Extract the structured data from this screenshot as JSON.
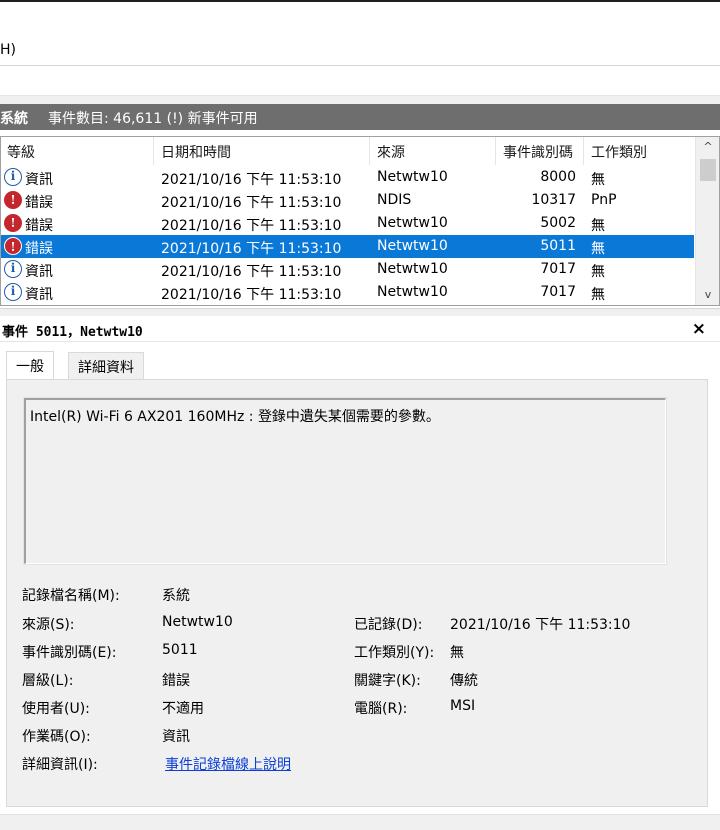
{
  "menubar": {
    "partial_item": "H)"
  },
  "header": {
    "title": "系統",
    "count_text": "事件數目: 46,611 (!) 新事件可用"
  },
  "grid": {
    "columns": [
      "等級",
      "日期和時間",
      "來源",
      "事件識別碼",
      "工作類別"
    ],
    "rows": [
      {
        "level": "資訊",
        "kind": "info",
        "datetime": "2021/10/16 下午 11:53:10",
        "source": "Netwtw10",
        "event_id": "8000",
        "category": "無",
        "selected": false
      },
      {
        "level": "錯誤",
        "kind": "error",
        "datetime": "2021/10/16 下午 11:53:10",
        "source": "NDIS",
        "event_id": "10317",
        "category": "PnP",
        "selected": false
      },
      {
        "level": "錯誤",
        "kind": "error",
        "datetime": "2021/10/16 下午 11:53:10",
        "source": "Netwtw10",
        "event_id": "5002",
        "category": "無",
        "selected": false
      },
      {
        "level": "錯誤",
        "kind": "error",
        "datetime": "2021/10/16 下午 11:53:10",
        "source": "Netwtw10",
        "event_id": "5011",
        "category": "無",
        "selected": true
      },
      {
        "level": "資訊",
        "kind": "info",
        "datetime": "2021/10/16 下午 11:53:10",
        "source": "Netwtw10",
        "event_id": "7017",
        "category": "無",
        "selected": false
      },
      {
        "level": "資訊",
        "kind": "info",
        "datetime": "2021/10/16 下午 11:53:10",
        "source": "Netwtw10",
        "event_id": "7017",
        "category": "無",
        "selected": false
      }
    ]
  },
  "icons": {
    "info_glyph": "i",
    "error_glyph": "!",
    "scroll_up": "^",
    "scroll_down": "v",
    "close": "×"
  },
  "detail": {
    "title": "事件 5011，Netwtw10",
    "tabs": [
      "一般",
      "詳細資料"
    ],
    "message": "Intel(R) Wi-Fi 6 AX201 160MHz : 登錄中遺失某個需要的參數。",
    "fields": {
      "log_name_label": "記錄檔名稱(M):",
      "log_name": "系統",
      "source_label": "來源(S):",
      "source": "Netwtw10",
      "logged_label": "已記錄(D):",
      "logged": "2021/10/16 下午 11:53:10",
      "event_id_label": "事件識別碼(E):",
      "event_id": "5011",
      "task_cat_label": "工作類別(Y):",
      "task_cat": "無",
      "level_label": "層級(L):",
      "level": "錯誤",
      "keywords_label": "關鍵字(K):",
      "keywords": "傳統",
      "user_label": "使用者(U):",
      "user": "不適用",
      "computer_label": "電腦(R):",
      "computer": "MSI",
      "opcode_label": "作業碼(O):",
      "opcode": "資訊",
      "more_info_label": "詳細資訊(I):",
      "more_info_link": "事件記錄檔線上說明"
    }
  }
}
